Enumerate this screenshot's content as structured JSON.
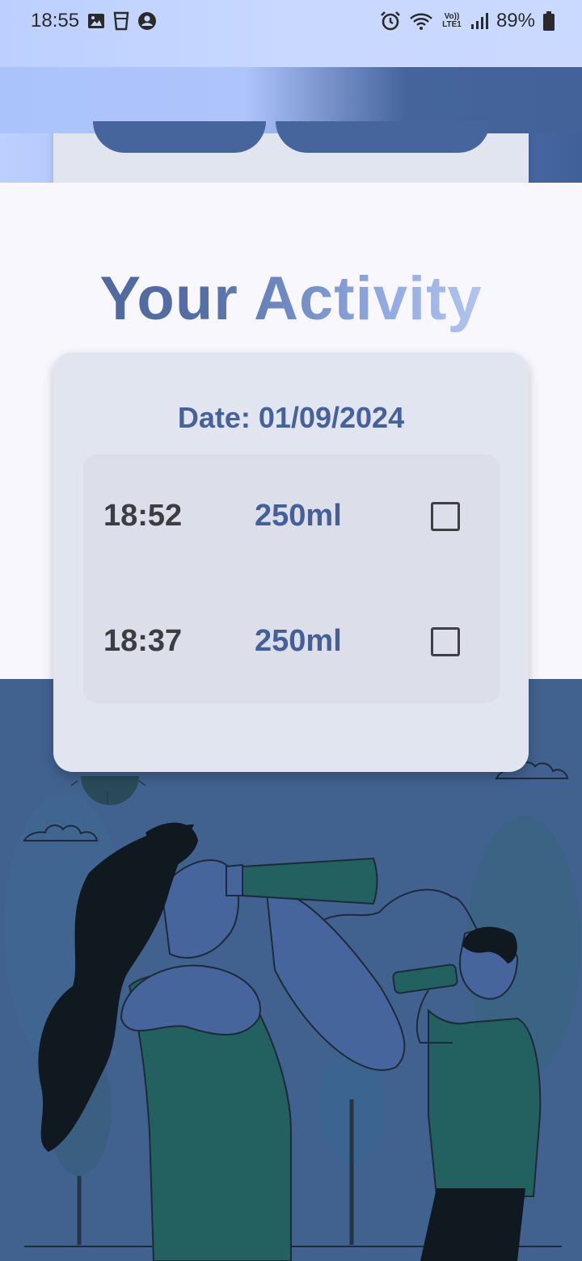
{
  "status_bar": {
    "time": "18:55",
    "battery": "89%",
    "icons_left": [
      "gallery-icon",
      "cup-icon",
      "account-icon"
    ],
    "icons_right": [
      "alarm-icon",
      "wifi-icon",
      "volte-icon",
      "signal-icon",
      "battery-icon"
    ],
    "volte_label": "Vo)) LTE1"
  },
  "colors": {
    "accent": "#46629a",
    "card": "#e1e5f0",
    "illustration_bg": "#41618f"
  },
  "activity": {
    "title": "Your Activity",
    "date_label": "Date: 01/09/2024",
    "entries": [
      {
        "time": "18:52",
        "amount": "250ml",
        "checked": false
      },
      {
        "time": "18:37",
        "amount": "250ml",
        "checked": false
      }
    ]
  }
}
